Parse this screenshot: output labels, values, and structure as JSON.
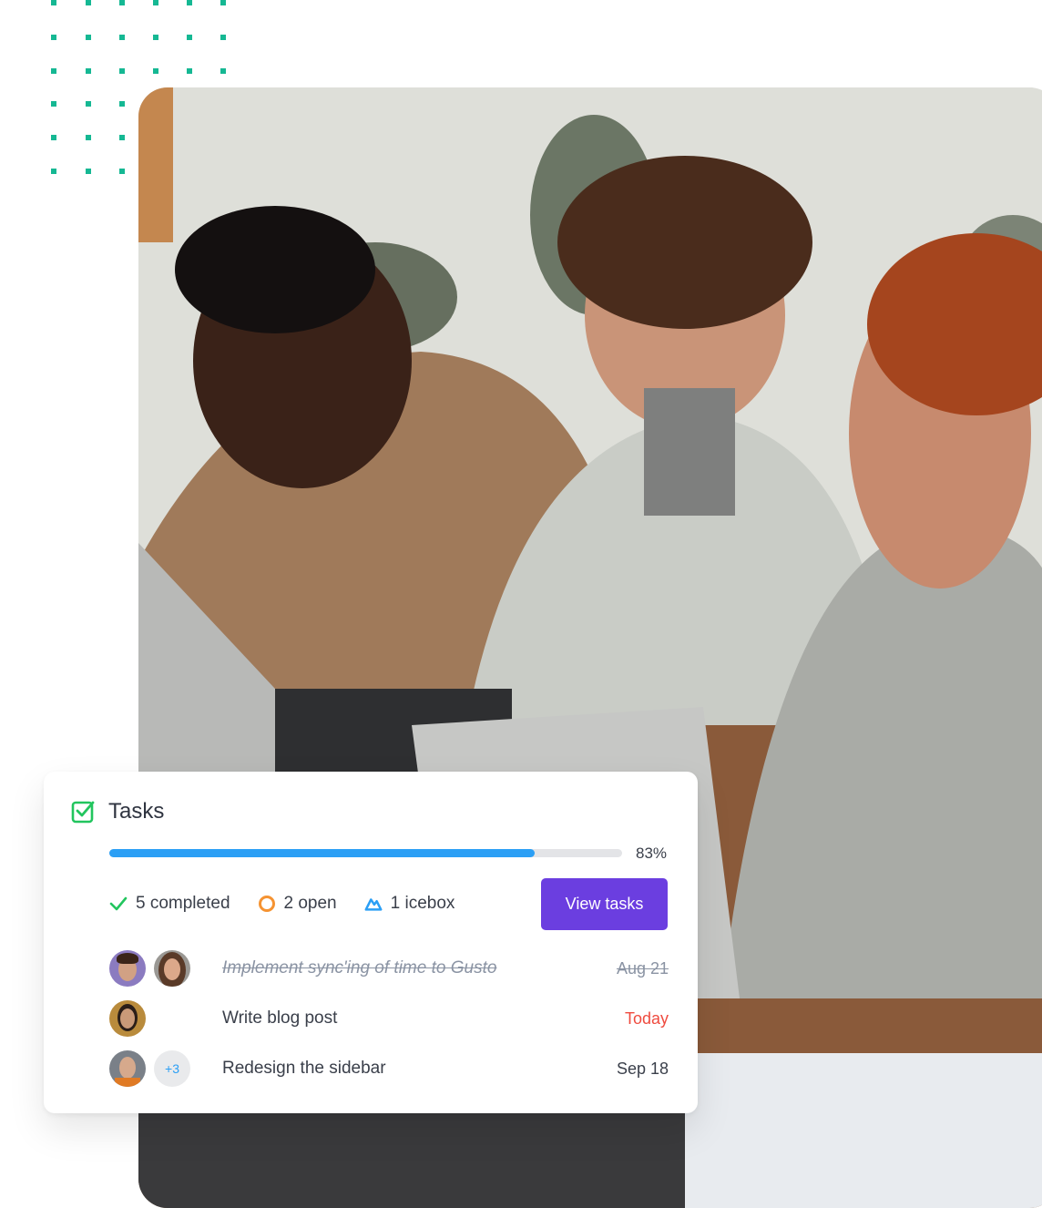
{
  "decor": {
    "dot_color": "#15b893",
    "photo_description": "Three coworkers smiling and talking around a table with laptops"
  },
  "tasks_card": {
    "title": "Tasks",
    "title_icon": "checkbox-checked-icon",
    "progress_percent": 83,
    "progress_label": "83%",
    "stats": [
      {
        "icon": "check-icon",
        "label": "5 completed",
        "color": "#22c55e"
      },
      {
        "icon": "open-circle-icon",
        "label": "2 open",
        "color": "#f59332"
      },
      {
        "icon": "icebox-mountain-icon",
        "label": "1 icebox",
        "color": "#2b9ff5"
      }
    ],
    "view_button": "View tasks",
    "items": [
      {
        "title": "Implement sync'ing of time to Gusto",
        "date": "Aug 21",
        "status": "completed",
        "assignees": 2,
        "extra": ""
      },
      {
        "title": "Write blog post",
        "date": "Today",
        "status": "due-today",
        "assignees": 1,
        "extra": ""
      },
      {
        "title": "Redesign the sidebar",
        "date": "Sep 18",
        "status": "open",
        "assignees": 1,
        "extra": "+3"
      }
    ]
  }
}
